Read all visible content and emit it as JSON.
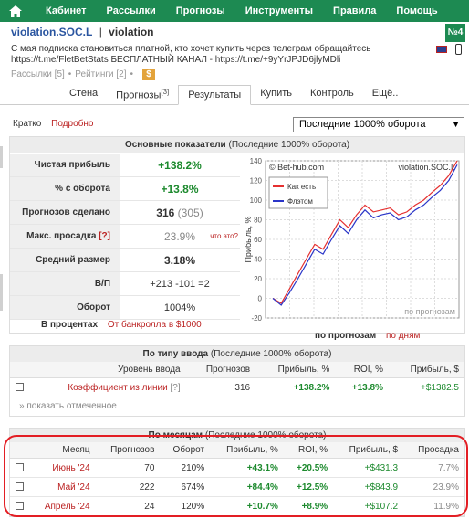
{
  "nav": {
    "items": [
      "Кабинет",
      "Рассылки",
      "Прогнозы",
      "Инструменты",
      "Правила",
      "Помощь"
    ]
  },
  "header": {
    "nick": "violation.SOC.L",
    "separator": "|",
    "name": "violation",
    "description": "С мая подписка становиться платной, кто хочет купить через телеграм обращайтесь https://t.me/FletBetStats БЕСПЛАТНЫЙ КАНАЛ - https://t.me/+9yYrJPJD6jlyMDli",
    "mailings": "Рассылки [5]",
    "ratings": "Рейтинги [2]",
    "dot": "•",
    "dollar": "$",
    "badge": "№4"
  },
  "tabs": [
    {
      "label": "Стена",
      "sup": ""
    },
    {
      "label": "Прогнозы",
      "sup": "[3]"
    },
    {
      "label": "Результаты",
      "sup": ""
    },
    {
      "label": "Купить",
      "sup": ""
    },
    {
      "label": "Контроль",
      "sup": ""
    },
    {
      "label": "Ещё..",
      "sup": ""
    }
  ],
  "mode": {
    "brief": "Кратко",
    "detail": "Подробно"
  },
  "select": {
    "value": "Последние 1000% оборота"
  },
  "main_panel": {
    "title_bold": "Основные показатели",
    "title_rest": "(Последние 1000% оборота)",
    "stats": [
      {
        "label": "Чистая прибыль",
        "value": "+138.2%"
      },
      {
        "label": "% с оборота",
        "value": "+13.8%"
      },
      {
        "label": "Прогнозов сделано",
        "value": "316",
        "extra": "(305)"
      },
      {
        "label": "Макс. просадка",
        "link": "[?]",
        "value": "23.9%",
        "extra": "что это?"
      },
      {
        "label": "Средний размер",
        "value": "3.18%"
      },
      {
        "label": "В/П",
        "value": "+213 -101 =2"
      },
      {
        "label": "Оборот",
        "value": "1004%"
      }
    ],
    "pct_label": "В процентах",
    "bank_label": "От банкролла в $1000",
    "axis_label": "по прогнозам",
    "axis_alt": "по дням"
  },
  "chart_data": {
    "type": "line",
    "site": "© Bet-hub.com",
    "title": "violation.SOC.L",
    "ylabel": "Прибыль, %",
    "xlabel": "по прогнозам",
    "ylim": [
      -20,
      140
    ],
    "yticks": [
      -20,
      0,
      20,
      40,
      60,
      80,
      100,
      120,
      140
    ],
    "grid": true,
    "legend_position": "top-left",
    "series": [
      {
        "name": "Как есть",
        "color": "#e53030",
        "values": [
          0,
          -5,
          10,
          25,
          40,
          55,
          50,
          65,
          80,
          72,
          85,
          95,
          88,
          90,
          92,
          85,
          88,
          95,
          100,
          108,
          115,
          125,
          140
        ]
      },
      {
        "name": "Флэтом",
        "color": "#2a35c8",
        "values": [
          0,
          -7,
          6,
          20,
          35,
          50,
          45,
          60,
          74,
          66,
          80,
          90,
          82,
          85,
          87,
          80,
          83,
          90,
          95,
          103,
          110,
          120,
          136
        ]
      }
    ]
  },
  "type_panel": {
    "title_bold": "По типу ввода",
    "title_rest": "(Последние 1000% оборота)",
    "columns": [
      "Уровень ввода",
      "Прогнозов",
      "Прибыль, %",
      "ROI, %",
      "Прибыль, $"
    ],
    "rows": [
      {
        "level": "Коэффициент из линии",
        "help": "[?]",
        "count": "316",
        "profit_pct": "+138.2%",
        "roi": "+13.8%",
        "profit_usd": "+$1382.5"
      }
    ],
    "show_marked": "» показать отмеченное"
  },
  "month_panel": {
    "title_bold": "По месяцам",
    "title_rest": "(Последние 1000% оборота)",
    "columns": [
      "Месяц",
      "Прогнозов",
      "Оборот",
      "Прибыль, %",
      "ROI, %",
      "Прибыль, $",
      "Просадка"
    ],
    "rows": [
      {
        "month": "Июнь '24",
        "count": "70",
        "turnover": "210%",
        "profit_pct": "+43.1%",
        "roi": "+20.5%",
        "profit_usd": "+$431.3",
        "drawdown": "7.7%"
      },
      {
        "month": "Май '24",
        "count": "222",
        "turnover": "674%",
        "profit_pct": "+84.4%",
        "roi": "+12.5%",
        "profit_usd": "+$843.9",
        "drawdown": "23.9%"
      },
      {
        "month": "Апрель '24",
        "count": "24",
        "turnover": "120%",
        "profit_pct": "+10.7%",
        "roi": "+8.9%",
        "profit_usd": "+$107.2",
        "drawdown": "11.9%"
      }
    ]
  }
}
